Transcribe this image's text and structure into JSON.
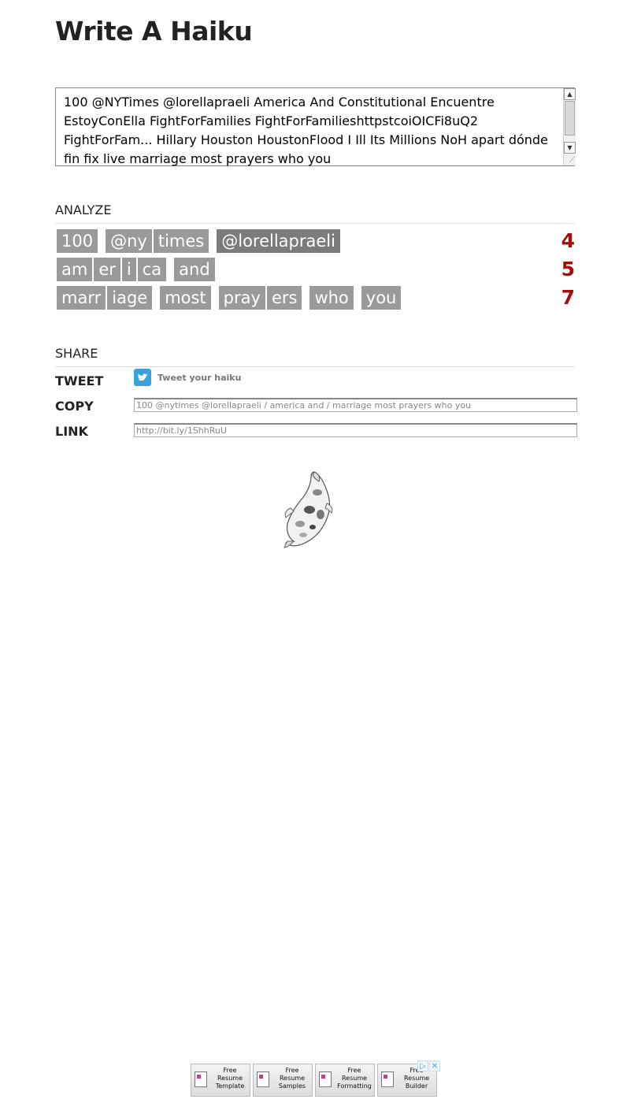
{
  "page": {
    "title": "Write A Haiku"
  },
  "editor": {
    "text": " 100 @NYTimes @lorellapraeli America And Constitutional Encuentre EstoyConElla FightForFamilies FightForFamilieshttpstcoiOICFi8uQ2 FightForFam... Hillary Houston HoustonFlood I Ill Its Millions NoH apart dónde fin fix live marriage most prayers who you"
  },
  "analyze": {
    "heading": "ANALYZE",
    "lines": [
      {
        "count": "4",
        "words": [
          [
            "100"
          ],
          [
            "@ny",
            "times"
          ],
          [
            "@lorellapraeli"
          ]
        ]
      },
      {
        "count": "5",
        "words": [
          [
            "am",
            "er",
            "i",
            "ca"
          ],
          [
            "and"
          ]
        ]
      },
      {
        "count": "7",
        "words": [
          [
            "marr",
            "iage"
          ],
          [
            "most"
          ],
          [
            "pray",
            "ers"
          ],
          [
            "who"
          ],
          [
            "you"
          ]
        ]
      }
    ]
  },
  "share": {
    "heading": "SHARE",
    "tweet_label": "TWEET",
    "tweet_text": "Tweet your haiku",
    "copy_label": "COPY",
    "copy_value": "100 @nytimes @lorellapraeli / america and / marriage most prayers who you",
    "link_label": "LINK",
    "link_value": "http://bit.ly/1ShhRuU"
  },
  "ads": {
    "tiles": [
      {
        "text": "Free Resume Template"
      },
      {
        "text": "Free Resume Samples"
      },
      {
        "text": "Free Resume Formatting"
      },
      {
        "text": "Free Resume Builder"
      }
    ],
    "adchoices_icon": "▷",
    "close_icon": "✕"
  },
  "colors": {
    "syllable_bg": "#9a9a9a",
    "count": "#a11010",
    "twitter": "#3aa2d8"
  }
}
